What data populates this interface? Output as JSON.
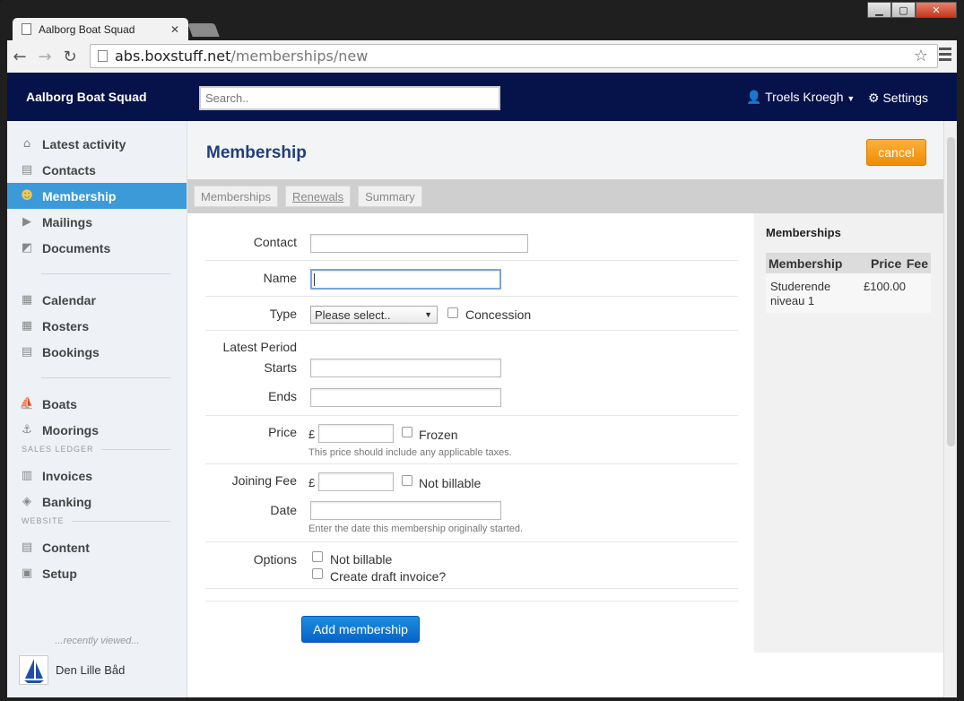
{
  "browser": {
    "tab_title": "Aalborg Boat Squad",
    "url_host": "abs.boxstuff.net",
    "url_path": "/memberships/new"
  },
  "topnav": {
    "brand": "Aalborg Boat Squad",
    "search_placeholder": "Search..",
    "user": "Troels Kroegh",
    "settings": "Settings"
  },
  "sidebar": {
    "items": [
      {
        "label": "Latest activity",
        "icon": "home-icon"
      },
      {
        "label": "Contacts",
        "icon": "contacts-icon"
      },
      {
        "label": "Membership",
        "icon": "membership-icon"
      },
      {
        "label": "Mailings",
        "icon": "mailings-icon"
      },
      {
        "label": "Documents",
        "icon": "documents-icon"
      },
      {
        "label": "Calendar",
        "icon": "calendar-icon"
      },
      {
        "label": "Rosters",
        "icon": "rosters-icon"
      },
      {
        "label": "Bookings",
        "icon": "bookings-icon"
      },
      {
        "label": "Boats",
        "icon": "boats-icon"
      },
      {
        "label": "Moorings",
        "icon": "anchor-icon"
      },
      {
        "label": "Invoices",
        "icon": "invoices-icon"
      },
      {
        "label": "Banking",
        "icon": "banking-icon"
      },
      {
        "label": "Content",
        "icon": "content-icon"
      },
      {
        "label": "Setup",
        "icon": "setup-icon"
      }
    ],
    "sales_ledger_header": "SALES LEDGER",
    "website_header": "WEBSITE",
    "recent_label": "...recently viewed...",
    "recent_item": "Den Lille Båd"
  },
  "page": {
    "title": "Membership",
    "cancel": "cancel",
    "tabs": [
      "Memberships",
      "Renewals",
      "Summary"
    ]
  },
  "form": {
    "contact_label": "Contact",
    "name_label": "Name",
    "type_label": "Type",
    "type_value": "Please select..",
    "concession_label": "Concession",
    "latest_period_label": "Latest Period",
    "starts_label": "Starts",
    "ends_label": "Ends",
    "price_label": "Price",
    "currency": "£",
    "frozen_label": "Frozen",
    "price_hint": "This price should include any applicable taxes.",
    "joining_fee_label": "Joining Fee",
    "not_billable_label": "Not billable",
    "date_label": "Date",
    "date_hint": "Enter the date this membership originally started.",
    "options_label": "Options",
    "options_not_billable": "Not billable",
    "options_draft_invoice": "Create draft invoice?",
    "submit": "Add membership"
  },
  "panel": {
    "title": "Memberships",
    "headers": [
      "Membership",
      "Price",
      "Fee"
    ],
    "rows": [
      {
        "membership": "Studerende niveau 1",
        "price": "£100.00",
        "fee": ""
      }
    ]
  }
}
